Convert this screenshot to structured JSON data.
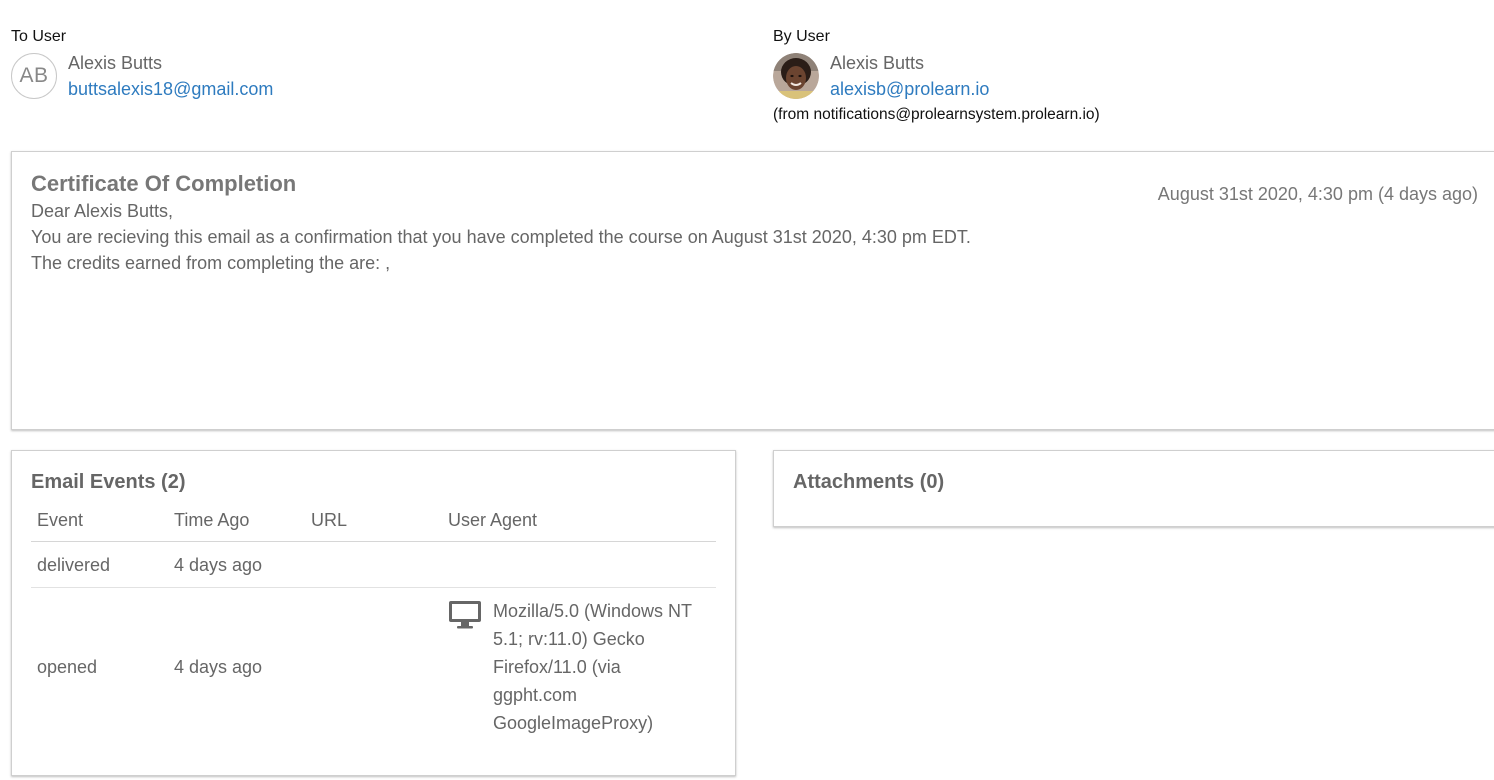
{
  "to_user": {
    "label": "To User",
    "initials": "AB",
    "name": "Alexis Butts",
    "email": "buttsalexis18@gmail.com"
  },
  "by_user": {
    "label": "By User",
    "name": "Alexis Butts",
    "email": "alexisb@prolearn.io",
    "from_note": "(from notifications@prolearnsystem.prolearn.io)"
  },
  "email": {
    "subject": "Certificate Of Completion",
    "date": "August 31st 2020, 4:30 pm (4 days ago)",
    "greeting": "Dear Alexis Butts,",
    "paragraph1": "You are recieving this email as a confirmation that you have completed the course on August 31st 2020, 4:30 pm EDT.",
    "paragraph2": "The credits earned from completing the are: ,"
  },
  "email_events": {
    "title": "Email Events (2)",
    "columns": [
      "Event",
      "Time Ago",
      "URL",
      "User Agent"
    ],
    "rows": [
      {
        "event": "delivered",
        "time_ago": "4 days ago",
        "url": "",
        "user_agent": ""
      },
      {
        "event": "opened",
        "time_ago": "4 days ago",
        "url": "",
        "user_agent": "Mozilla/5.0 (Windows NT 5.1; rv:11.0) Gecko Firefox/11.0 (via ggpht.com GoogleImageProxy)",
        "device_icon": "desktop-monitor-icon"
      }
    ]
  },
  "attachments": {
    "title": "Attachments (0)"
  },
  "colors": {
    "link": "#2e7bbf",
    "muted_text": "#666666",
    "border": "#cfcfcf"
  }
}
